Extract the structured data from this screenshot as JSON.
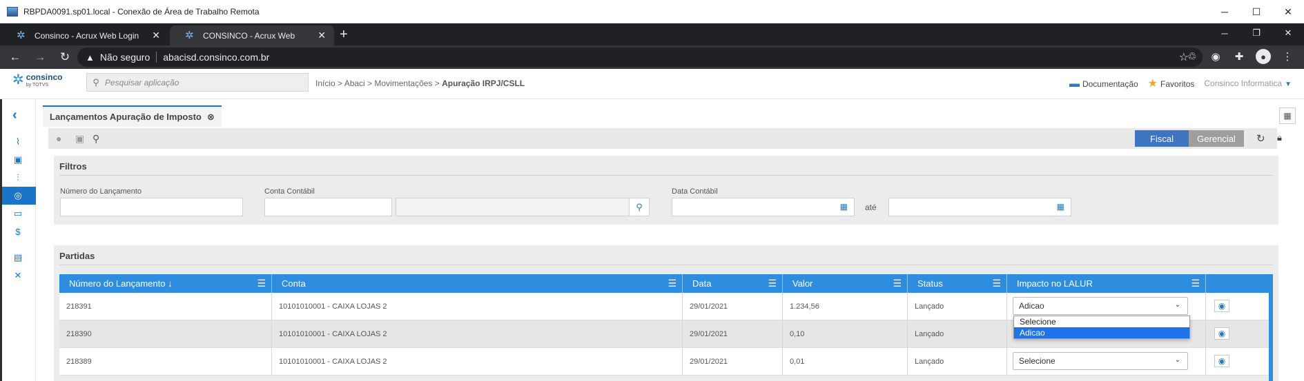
{
  "rdp": {
    "title": "RBPDA0091.sp01.local - Conexão de Área de Trabalho Remota"
  },
  "browser": {
    "tabs": [
      {
        "label": "Consinco - Acrux Web Login"
      },
      {
        "label": "CONSINCO - Acrux Web"
      }
    ],
    "security_label": "Não seguro",
    "url": "abacisd.consinco.com.br"
  },
  "app": {
    "logo": {
      "name": "consinco",
      "sub": "by TOTVS"
    },
    "search_placeholder": "Pesquisar aplicação",
    "breadcrumb": {
      "path": "Início > Abaci > Movimentações > ",
      "current": "Apuração IRPJ/CSLL"
    },
    "header_links": {
      "docs": "Documentação",
      "favorites": "Favoritos",
      "company": "Consinco Informatica"
    }
  },
  "page": {
    "tab_title": "Lançamentos Apuração de Imposto",
    "toggle": {
      "fiscal": "Fiscal",
      "gerencial": "Gerencial"
    },
    "filters": {
      "title": "Filtros",
      "numero_label": "Número do Lançamento",
      "conta_label": "Conta Contábil",
      "data_label": "Data Contábil",
      "ate_label": "até"
    },
    "partidas": {
      "title": "Partidas",
      "columns": [
        "Número do Lançamento",
        "Conta",
        "Data",
        "Valor",
        "Status",
        "Impacto no LALUR"
      ],
      "sort_indicator": "↓",
      "rows": [
        {
          "numero": "218391",
          "conta": "10101010001 - CAIXA LOJAS 2",
          "data": "29/01/2021",
          "valor": "1.234,56",
          "status": "Lançado",
          "impacto": "Adicao"
        },
        {
          "numero": "218390",
          "conta": "10101010001 - CAIXA LOJAS 2",
          "data": "29/01/2021",
          "valor": "0,10",
          "status": "Lançado",
          "impacto": ""
        },
        {
          "numero": "218389",
          "conta": "10101010001 - CAIXA LOJAS 2",
          "data": "29/01/2021",
          "valor": "0,01",
          "status": "Lançado",
          "impacto": "Selecione"
        }
      ],
      "dropdown_options": [
        "Selecione",
        "Adicao"
      ],
      "dropdown_selected": "Adicao"
    }
  },
  "colors": {
    "accent": "#1a74c9",
    "grid_header": "#2f8ddf",
    "fiscal_active": "#3f74c2",
    "gerencial": "#9e9e9e",
    "favorite_star": "#f5a623"
  }
}
